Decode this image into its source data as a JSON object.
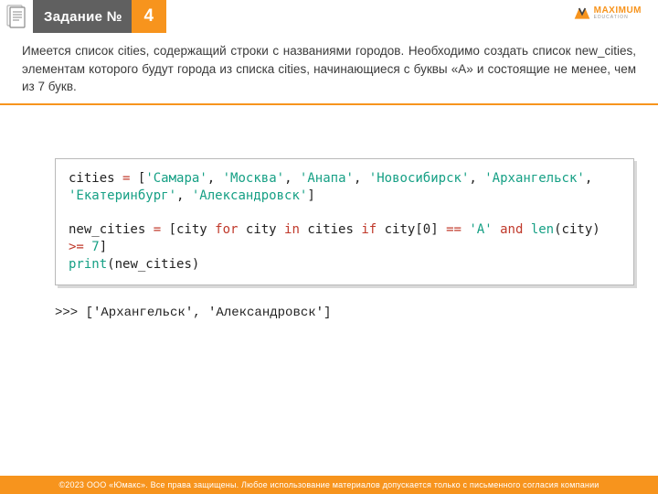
{
  "header": {
    "title_label": "Задание №",
    "task_number": "4",
    "logo_text": "MAXIMUM",
    "logo_sub": "EDUCATION"
  },
  "task": {
    "description": "Имеется список cities, содержащий строки с названиями городов. Необходимо создать список new_cities, элементам которого будут города из списка cities, начинающиеся с буквы «А» и состоящие не менее, чем из 7 букв."
  },
  "code": {
    "line1_prefix": "cities ",
    "eq": "=",
    "sp": " ",
    "lbr": "[",
    "rbr": "]",
    "s1": "'Самара'",
    "s2": "'Москва'",
    "s3": "'Анапа'",
    "s4": "'Новосибирск'",
    "s5": "'Архангельск'",
    "s6": "'Екатеринбург'",
    "s7": "'Александровск'",
    "comma": ", ",
    "blank": " ",
    "nc_prefix": "new_cities ",
    "lc_a": " [city ",
    "for": "for",
    "lc_b": " city ",
    "in": "in",
    "lc_c": " cities ",
    "if": "if",
    "lc_d": " city[0] ",
    "eqeq": "==",
    "lc_e": " ",
    "letA": "'А'",
    "and": "and",
    "len": "len",
    "lc_f": "(city) ",
    "ge": ">=",
    "seven": "7",
    "print": "print",
    "print_a": "(new_cities)"
  },
  "output": {
    "text": ">>> ['Архангельск', 'Александровск']"
  },
  "footer": {
    "text": "©2023 ООО «Юмакс». Все права защищены. Любое использование материалов допускается только с письменного согласия компании"
  }
}
